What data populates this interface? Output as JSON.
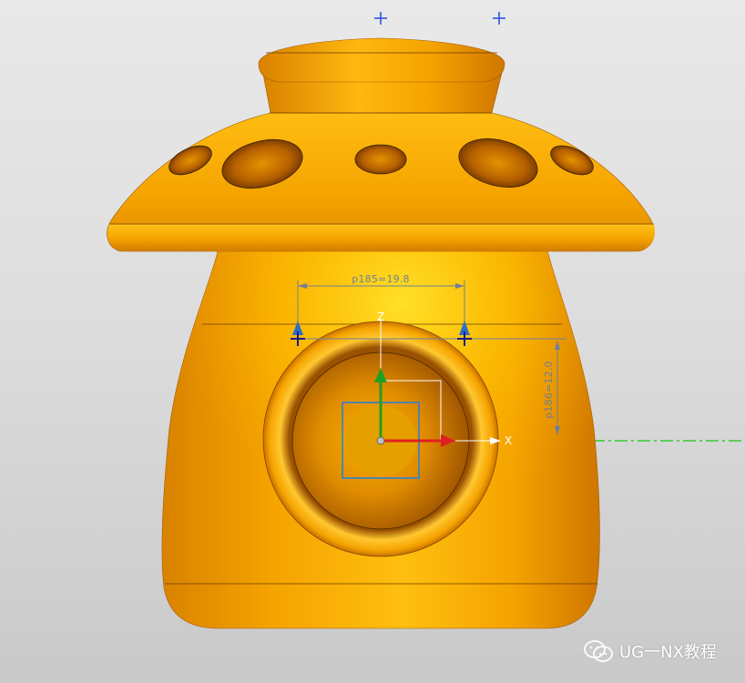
{
  "viewport": {
    "background_top": "#e9e9e9",
    "background_bottom": "#c9c9c9"
  },
  "model": {
    "name": "mushroom-house",
    "body_color": "#f5a300",
    "highlight_color": "#ffd21a",
    "shadow_color": "#c26a00",
    "edge_color": "#6b3c00"
  },
  "dimensions": {
    "horizontal": {
      "label": "p185=19.8",
      "color": "#6f7e99"
    },
    "vertical": {
      "label": "p186=12.0",
      "color": "#6f7e99"
    }
  },
  "csys": {
    "x_label": "X",
    "x_color": "#e02020",
    "y_color": "#20a020",
    "z_label": "Z"
  },
  "datum_line_color": "#33cc33",
  "watermark": {
    "text": "UG一NX教程"
  }
}
